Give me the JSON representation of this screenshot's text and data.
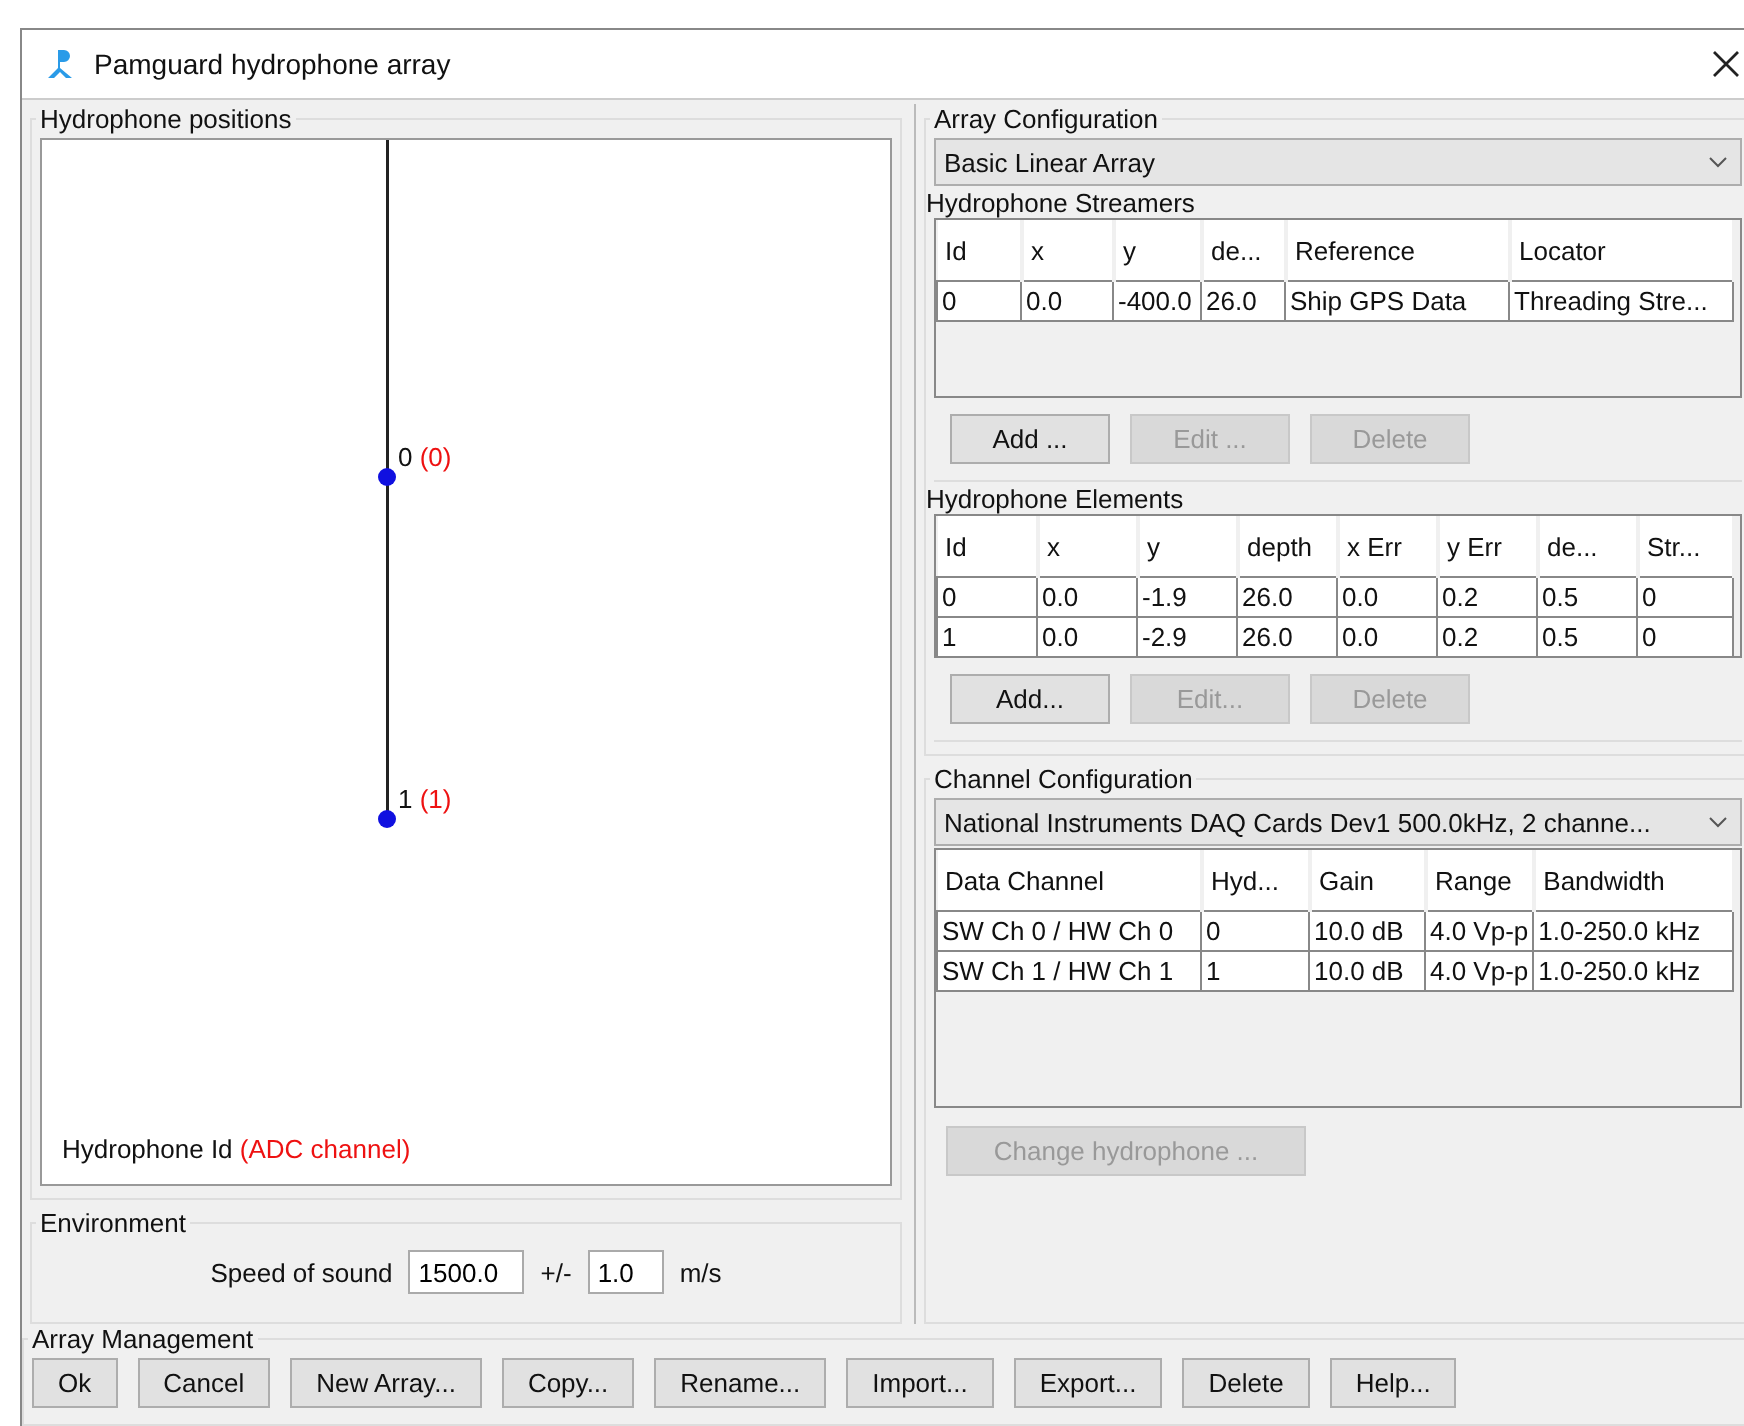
{
  "window": {
    "title": "Pamguard hydrophone array"
  },
  "positions": {
    "title": "Hydrophone positions",
    "hydrophones": [
      {
        "id": "0",
        "channel": "(0)"
      },
      {
        "id": "1",
        "channel": "(1)"
      }
    ],
    "legend": {
      "id": "Hydrophone Id",
      "channel": "(ADC channel)"
    }
  },
  "environment": {
    "title": "Environment",
    "label": "Speed of sound",
    "value": "1500.0",
    "pm": "+/-",
    "error": "1.0",
    "unit": "m/s"
  },
  "array_configuration": {
    "title": "Array Configuration",
    "dropdown": "Basic Linear Array",
    "streamers": {
      "title": "Hydrophone Streamers",
      "columns": [
        "Id",
        "x",
        "y",
        "de...",
        "Reference",
        "Locator"
      ],
      "rows": [
        [
          "0",
          "0.0",
          "-400.0",
          "26.0",
          "Ship GPS Data",
          "Threading Stre..."
        ]
      ],
      "buttons": [
        {
          "label": "Add ...",
          "disabled": false
        },
        {
          "label": "Edit ...",
          "disabled": true
        },
        {
          "label": "Delete",
          "disabled": true
        }
      ]
    },
    "elements": {
      "title": "Hydrophone Elements",
      "columns": [
        "Id",
        "x",
        "y",
        "depth",
        "x Err",
        "y Err",
        "de...",
        "Str..."
      ],
      "rows": [
        [
          "0",
          "0.0",
          "-1.9",
          "26.0",
          "0.0",
          "0.2",
          "0.5",
          "0"
        ],
        [
          "1",
          "0.0",
          "-2.9",
          "26.0",
          "0.0",
          "0.2",
          "0.5",
          "0"
        ]
      ],
      "buttons": [
        {
          "label": "Add...",
          "disabled": false
        },
        {
          "label": "Edit...",
          "disabled": true
        },
        {
          "label": "Delete",
          "disabled": true
        }
      ]
    }
  },
  "channel_configuration": {
    "title": "Channel Configuration",
    "dropdown": "National Instruments DAQ Cards Dev1 500.0kHz, 2 channe...",
    "columns": [
      "Data Channel",
      "Hyd...",
      "Gain",
      "Range",
      "Bandwidth"
    ],
    "rows": [
      [
        "SW Ch 0 / HW Ch 0",
        "0",
        "10.0 dB",
        "4.0 Vp-p",
        "1.0-250.0 kHz"
      ],
      [
        "SW Ch 1 / HW Ch 1",
        "1",
        "10.0 dB",
        "4.0 Vp-p",
        "1.0-250.0 kHz"
      ]
    ],
    "button": {
      "label": "Change hydrophone ...",
      "disabled": true
    }
  },
  "array_management": {
    "title": "Array Management",
    "buttons": [
      {
        "label": "Ok",
        "disabled": false
      },
      {
        "label": "Cancel",
        "disabled": false
      },
      {
        "label": "New Array...",
        "disabled": false
      },
      {
        "label": "Copy...",
        "disabled": false
      },
      {
        "label": "Rename...",
        "disabled": false
      },
      {
        "label": "Import...",
        "disabled": false
      },
      {
        "label": "Export...",
        "disabled": false
      },
      {
        "label": "Delete",
        "disabled": false
      },
      {
        "label": "Help...",
        "disabled": false
      }
    ]
  }
}
